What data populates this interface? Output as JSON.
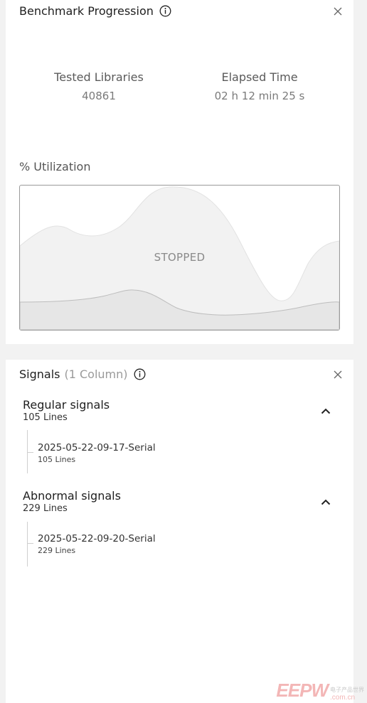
{
  "benchmark": {
    "title": "Benchmark Progression",
    "tested_label": "Tested Libraries",
    "tested_value": "40861",
    "elapsed_label": "Elapsed Time",
    "elapsed_value": "02 h 12 min 25 s",
    "utilization_label": "% Utilization",
    "chart_state": "STOPPED"
  },
  "signals": {
    "title": "Signals",
    "subtitle": "(1 Column)",
    "groups": [
      {
        "name": "Regular signals",
        "count": "105 Lines",
        "items": [
          {
            "name": "2025-05-22-09-17-Serial",
            "count": "105 Lines"
          }
        ]
      },
      {
        "name": "Abnormal signals",
        "count": "229 Lines",
        "items": [
          {
            "name": "2025-05-22-09-20-Serial",
            "count": "229 Lines"
          }
        ]
      }
    ]
  },
  "watermark": {
    "logo": "EEPW",
    "tagline": "电子产品世界",
    "domain": ".com.cn"
  },
  "icons": [
    "info-icon",
    "close-icon",
    "chevron-up-icon"
  ],
  "colors": {
    "panel": "#ffffff",
    "background": "#f2f2f2",
    "chart_area": "#f2f2f2",
    "chart_area_lower": "#e6e6e6"
  }
}
